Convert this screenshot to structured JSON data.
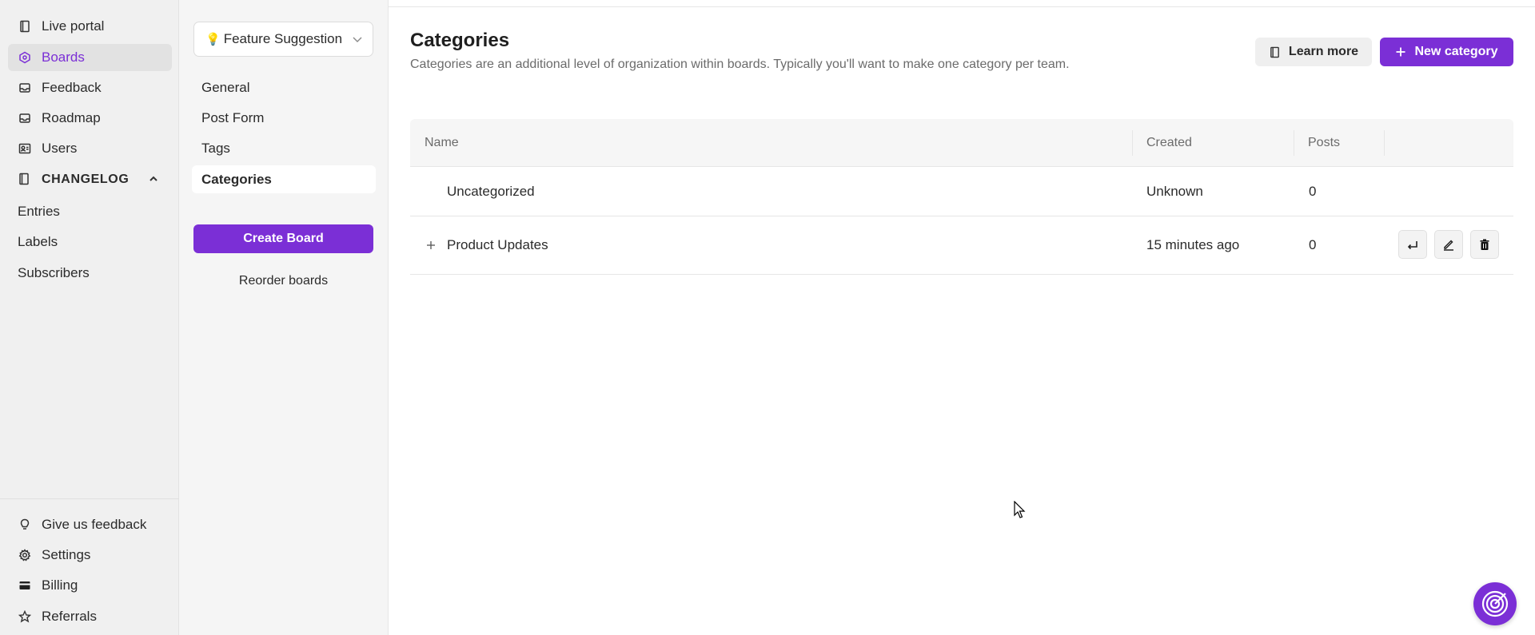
{
  "colors": {
    "accent": "#7b2fd6",
    "sidebar_bg": "#f0f0f0",
    "active_bg": "#e2e2e2"
  },
  "sidebar": {
    "items": [
      {
        "label": "Live portal",
        "icon": "book-icon"
      },
      {
        "label": "Boards",
        "icon": "boards-icon",
        "active": true
      },
      {
        "label": "Feedback",
        "icon": "inbox-icon"
      },
      {
        "label": "Roadmap",
        "icon": "roadmap-icon"
      },
      {
        "label": "Users",
        "icon": "users-icon"
      }
    ],
    "changelog": {
      "label": "CHANGELOG",
      "items": [
        "Entries",
        "Labels",
        "Subscribers"
      ]
    },
    "bottom": [
      {
        "label": "Give us feedback",
        "icon": "lightbulb-icon"
      },
      {
        "label": "Settings",
        "icon": "gear-icon"
      },
      {
        "label": "Billing",
        "icon": "credit-card-icon"
      },
      {
        "label": "Referrals",
        "icon": "star-icon"
      }
    ]
  },
  "boards_panel": {
    "selected_board": "Feature Suggestion",
    "links": [
      "General",
      "Post Form",
      "Tags",
      "Categories"
    ],
    "active_link": "Categories",
    "create_button": "Create Board",
    "reorder_link": "Reorder boards"
  },
  "main": {
    "title": "Categories",
    "description": "Categories are an additional level of organization within boards. Typically you'll want to make one category per team.",
    "learn_more": "Learn more",
    "new_category": "New category",
    "table": {
      "headers": {
        "name": "Name",
        "created": "Created",
        "posts": "Posts"
      },
      "rows": [
        {
          "name": "Uncategorized",
          "created": "Unknown",
          "posts": "0"
        },
        {
          "name": "Product Updates",
          "created": "15 minutes ago",
          "posts": "0"
        }
      ]
    }
  }
}
